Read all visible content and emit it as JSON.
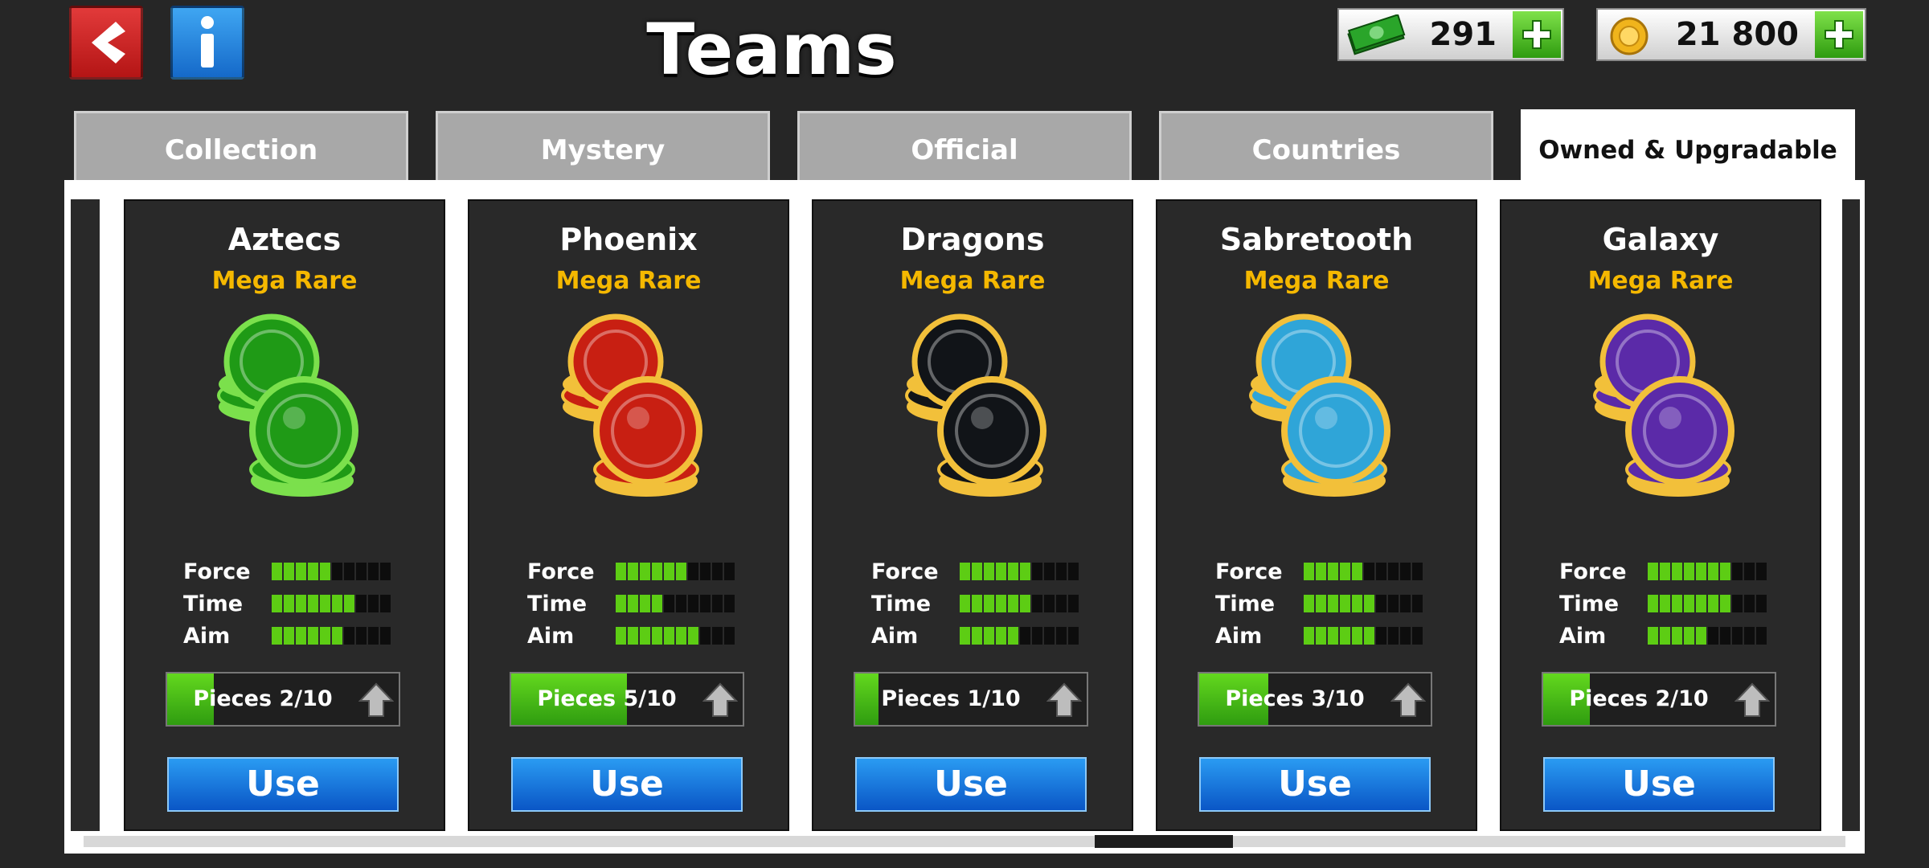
{
  "header": {
    "title": "Teams",
    "back_icon": "back-arrow-icon",
    "info_icon": "info-icon"
  },
  "currency": {
    "cash": {
      "amount": "291",
      "icon": "cash-icon"
    },
    "coins": {
      "amount": "21 800",
      "icon": "coin-icon"
    }
  },
  "tabs": [
    {
      "label": "Collection"
    },
    {
      "label": "Mystery"
    },
    {
      "label": "Official"
    },
    {
      "label": "Countries"
    },
    {
      "label": "Owned & Upgradable",
      "active": true
    }
  ],
  "stat_labels": {
    "force": "Force",
    "time": "Time",
    "aim": "Aim"
  },
  "cards": [
    {
      "name": "Aztecs",
      "rarity": "Mega Rare",
      "force": 5,
      "time": 7,
      "aim": 6,
      "pieces_text": "Pieces 2/10",
      "pieces_fraction": 0.2,
      "use_label": "Use",
      "colors": {
        "main": "#1f9a16",
        "rim": "#7be04c"
      }
    },
    {
      "name": "Phoenix",
      "rarity": "Mega Rare",
      "force": 6,
      "time": 4,
      "aim": 7,
      "pieces_text": "Pieces 5/10",
      "pieces_fraction": 0.5,
      "use_label": "Use",
      "colors": {
        "main": "#c81f12",
        "rim": "#f2c03a"
      }
    },
    {
      "name": "Dragons",
      "rarity": "Mega Rare",
      "force": 6,
      "time": 6,
      "aim": 5,
      "pieces_text": "Pieces 1/10",
      "pieces_fraction": 0.1,
      "use_label": "Use",
      "colors": {
        "main": "#111418",
        "rim": "#f2c03a"
      }
    },
    {
      "name": "Sabretooth",
      "rarity": "Mega Rare",
      "force": 5,
      "time": 6,
      "aim": 6,
      "pieces_text": "Pieces 3/10",
      "pieces_fraction": 0.3,
      "use_label": "Use",
      "colors": {
        "main": "#2fa5d8",
        "rim": "#f2c03a"
      }
    },
    {
      "name": "Galaxy",
      "rarity": "Mega Rare",
      "force": 7,
      "time": 7,
      "aim": 5,
      "pieces_text": "Pieces 2/10",
      "pieces_fraction": 0.2,
      "use_label": "Use",
      "colors": {
        "main": "#5b2aa8",
        "rim": "#f2c03a"
      }
    }
  ]
}
